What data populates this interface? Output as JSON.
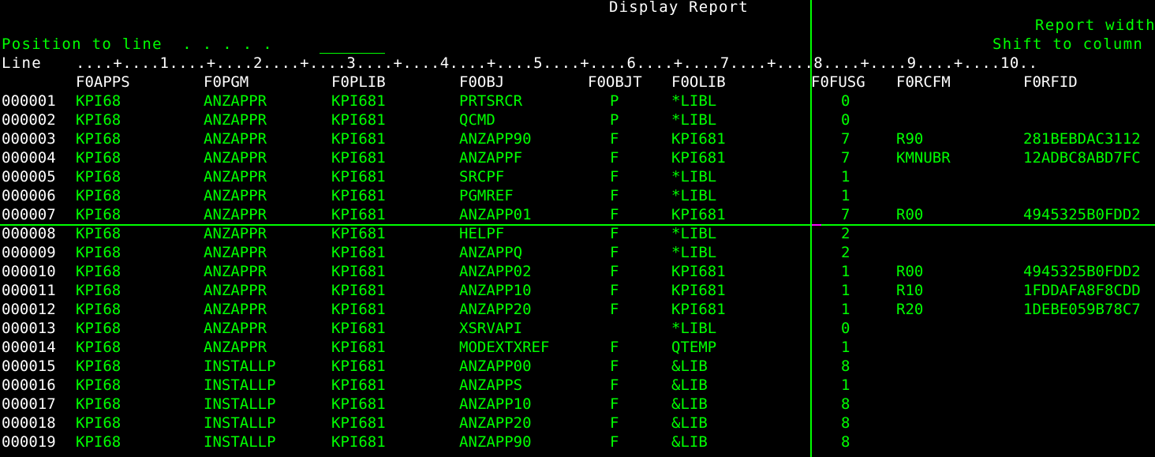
{
  "header": {
    "title": "Display Report",
    "report_width_label": "Report width",
    "position_label": "Position to line  . . . . .",
    "position_value": "",
    "shift_label": "Shift to column",
    "line_label": "Line",
    "ruler": "....+....1....+....2....+....3....+....4....+....5....+....6....+....7....+....8....+....9....+....10.."
  },
  "columns": [
    "F0APPS",
    "F0PGM",
    "F0PLIB",
    "F0OBJ",
    "F0OBJT",
    "F0OLIB",
    "F0FUSG",
    "F0RCFM",
    "F0RFID"
  ],
  "rows": [
    {
      "line": "000001",
      "cells": [
        "KPI68",
        "ANZAPPR",
        "KPI681",
        "PRTSRCR",
        "P",
        "*LIBL",
        "0",
        "",
        ""
      ]
    },
    {
      "line": "000002",
      "cells": [
        "KPI68",
        "ANZAPPR",
        "KPI681",
        "QCMD",
        "P",
        "*LIBL",
        "0",
        "",
        ""
      ]
    },
    {
      "line": "000003",
      "cells": [
        "KPI68",
        "ANZAPPR",
        "KPI681",
        "ANZAPP90",
        "F",
        "KPI681",
        "7",
        "R90",
        "281BEBDAC3112"
      ]
    },
    {
      "line": "000004",
      "cells": [
        "KPI68",
        "ANZAPPR",
        "KPI681",
        "ANZAPPF",
        "F",
        "KPI681",
        "7",
        "KMNUBR",
        "12ADBC8ABD7FC"
      ]
    },
    {
      "line": "000005",
      "cells": [
        "KPI68",
        "ANZAPPR",
        "KPI681",
        "SRCPF",
        "F",
        "*LIBL",
        "1",
        "",
        ""
      ]
    },
    {
      "line": "000006",
      "cells": [
        "KPI68",
        "ANZAPPR",
        "KPI681",
        "PGMREF",
        "F",
        "*LIBL",
        "1",
        "",
        ""
      ]
    },
    {
      "line": "000007",
      "cells": [
        "KPI68",
        "ANZAPPR",
        "KPI681",
        "ANZAPP01",
        "F",
        "KPI681",
        "7",
        "R00",
        "4945325B0FDD2"
      ]
    },
    {
      "line": "000008",
      "cells": [
        "KPI68",
        "ANZAPPR",
        "KPI681",
        "HELPF",
        "F",
        "*LIBL",
        "2",
        "",
        ""
      ]
    },
    {
      "line": "000009",
      "cells": [
        "KPI68",
        "ANZAPPR",
        "KPI681",
        "ANZAPPQ",
        "F",
        "*LIBL",
        "2",
        "",
        ""
      ]
    },
    {
      "line": "000010",
      "cells": [
        "KPI68",
        "ANZAPPR",
        "KPI681",
        "ANZAPP02",
        "F",
        "KPI681",
        "1",
        "R00",
        "4945325B0FDD2"
      ]
    },
    {
      "line": "000011",
      "cells": [
        "KPI68",
        "ANZAPPR",
        "KPI681",
        "ANZAPP10",
        "F",
        "KPI681",
        "1",
        "R10",
        "1FDDAFA8F8CDD"
      ]
    },
    {
      "line": "000012",
      "cells": [
        "KPI68",
        "ANZAPPR",
        "KPI681",
        "ANZAPP20",
        "F",
        "KPI681",
        "1",
        "R20",
        "1DEBE059B78C7"
      ]
    },
    {
      "line": "000013",
      "cells": [
        "KPI68",
        "ANZAPPR",
        "KPI681",
        "XSRVAPI",
        "",
        "*LIBL",
        "0",
        "",
        ""
      ]
    },
    {
      "line": "000014",
      "cells": [
        "KPI68",
        "ANZAPPR",
        "KPI681",
        "MODEXTXREF",
        "F",
        "QTEMP",
        "1",
        "",
        ""
      ]
    },
    {
      "line": "000015",
      "cells": [
        "KPI68",
        "INSTALLP",
        "KPI681",
        "ANZAPP00",
        "F",
        "&LIB",
        "8",
        "",
        ""
      ]
    },
    {
      "line": "000016",
      "cells": [
        "KPI68",
        "INSTALLP",
        "KPI681",
        "ANZAPPS",
        "F",
        "&LIB",
        "1",
        "",
        ""
      ]
    },
    {
      "line": "000017",
      "cells": [
        "KPI68",
        "INSTALLP",
        "KPI681",
        "ANZAPP10",
        "F",
        "&LIB",
        "8",
        "",
        ""
      ]
    },
    {
      "line": "000018",
      "cells": [
        "KPI68",
        "INSTALLP",
        "KPI681",
        "ANZAPP20",
        "F",
        "&LIB",
        "8",
        "",
        ""
      ]
    },
    {
      "line": "000019",
      "cells": [
        "KPI68",
        "INSTALLP",
        "KPI681",
        "ANZAPP90",
        "F",
        "&LIB",
        "8",
        "",
        ""
      ]
    }
  ],
  "colors": {
    "background": "#000000",
    "text_white": "#ffffff",
    "text_green": "#00ff00",
    "cursor_mark": "#ff00ff"
  }
}
